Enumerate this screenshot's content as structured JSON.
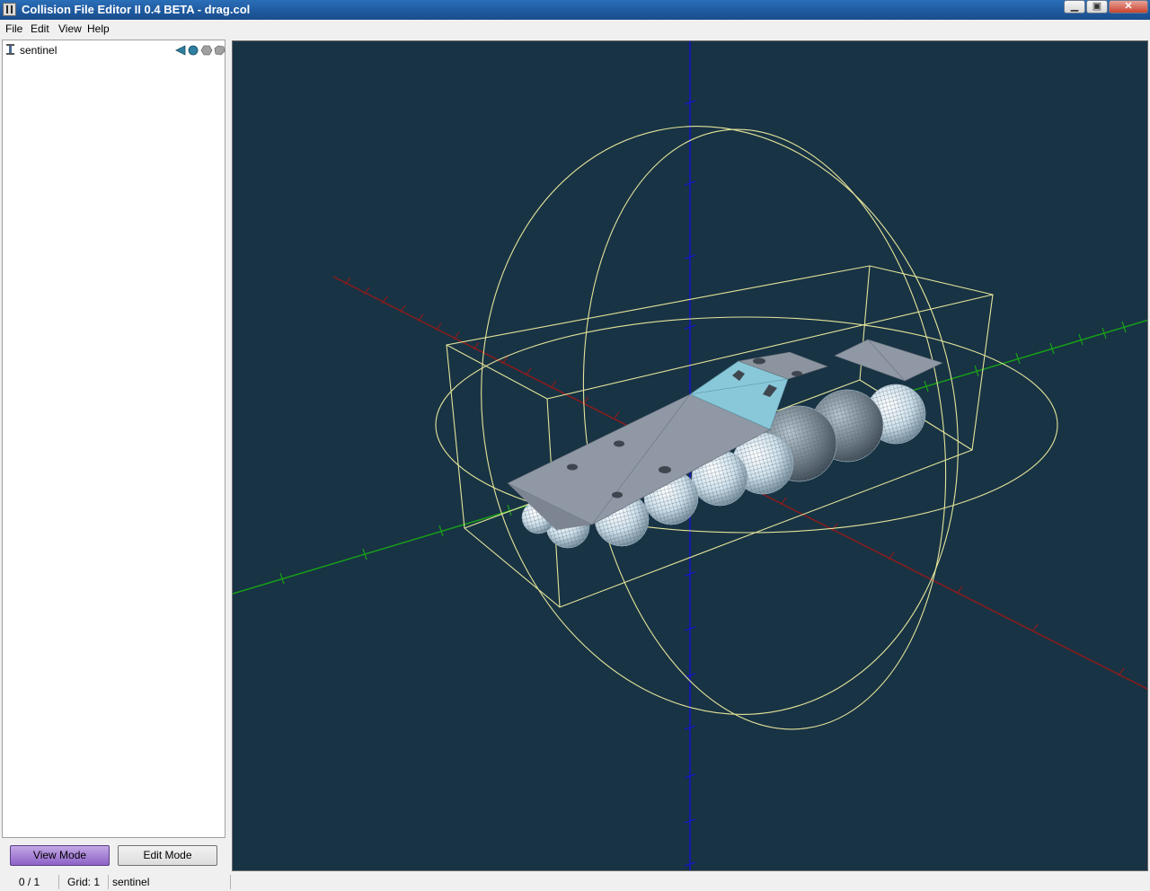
{
  "window": {
    "title": "Collision File Editor II 0.4 BETA - drag.col",
    "min_glyph": "▁",
    "max_glyph": "▣",
    "close_glyph": "✕"
  },
  "menu": [
    "File",
    "Edit",
    "View",
    "Help"
  ],
  "tree": {
    "items": [
      {
        "label": "sentinel",
        "shape_icons": [
          "face-group-icon",
          "sphere-icon",
          "box-icon",
          "mesh-icon"
        ]
      }
    ]
  },
  "modes": {
    "view_label": "View Mode",
    "edit_label": "Edit Mode",
    "active": "view"
  },
  "status": {
    "selection": "0 / 1",
    "grid": "Grid: 1",
    "model": "sentinel"
  },
  "viewport": {
    "background": "#183344",
    "axis_colors": {
      "x": "#8a1c1c",
      "y": "#18a018",
      "z": "#1010c0"
    },
    "bounds_color": "#e4e49a",
    "face_color": "#8f98a4",
    "selected_face_color": "#88c8d8",
    "sphere_count": 9
  }
}
